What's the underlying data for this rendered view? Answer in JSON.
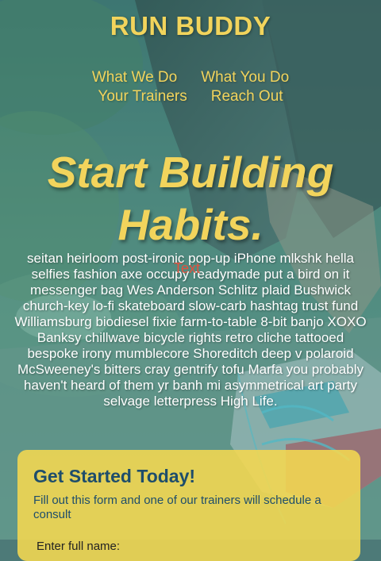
{
  "brand": {
    "name": "RUN BUDDY"
  },
  "nav": {
    "links": [
      "What We Do",
      "What You Do",
      "Your Trainers",
      "Reach Out"
    ]
  },
  "hero": {
    "headline_line1": "Start Building",
    "headline_line2": "Habits.",
    "body": "seitan heirloom post-ironic pop-up iPhone mlkshk hella selfies fashion axe occupy readymade put a bird on it messenger bag Wes Anderson Schlitz plaid Bushwick church-key lo-fi skateboard slow-carb hashtag trust fund Williamsburg biodiesel fixie farm-to-table 8-bit banjo XOXO Banksy chillwave bicycle rights retro cliche tattooed bespoke irony mumblecore Shoreditch deep v polaroid McSweeney's bitters cray gentrify tofu Marfa you probably haven't heard of them yr banh mi asymmetrical art party selvage letterpress High Life.",
    "stray_label": "Text"
  },
  "form": {
    "title": "Get Started Today!",
    "description": "Fill out this form and one of our trainers will schedule a consult",
    "name_label": "Enter full name:"
  },
  "colors": {
    "accent_yellow": "#f2d45c",
    "form_bg": "#f5d850",
    "form_text": "#1e4d6b",
    "stray_text": "#e2513e",
    "overlay_teal": "#388c82"
  }
}
